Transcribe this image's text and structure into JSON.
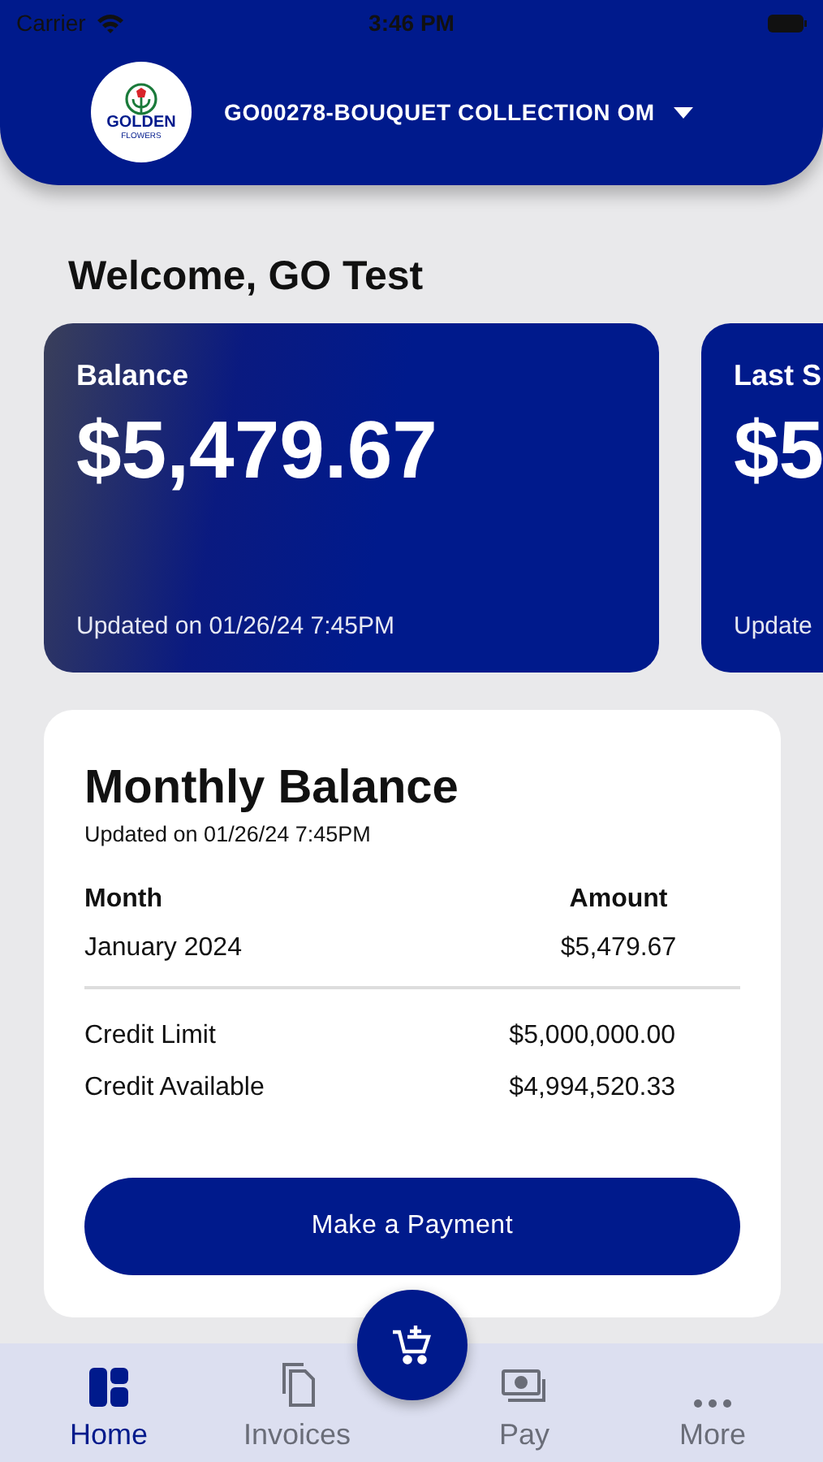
{
  "status_bar": {
    "carrier": "Carrier",
    "time": "3:46 PM"
  },
  "header": {
    "logo": {
      "name": "GOLDEN",
      "tagline": "FLOWERS"
    },
    "account": "GO00278-BOUQUET COLLECTION OM"
  },
  "welcome": "Welcome, GO Test",
  "summary_cards": [
    {
      "title": "Balance",
      "amount": "$5,479.67",
      "updated": "Updated on 01/26/24 7:45PM"
    },
    {
      "title": "Last S",
      "amount": "$5",
      "updated": "Update"
    }
  ],
  "monthly_balance": {
    "title": "Monthly Balance",
    "updated": "Updated on 01/26/24 7:45PM",
    "columns": [
      "Month",
      "Amount"
    ],
    "rows": [
      {
        "month": "January 2024",
        "amount": "$5,479.67"
      }
    ],
    "credit": [
      {
        "label": "Credit Limit",
        "value": "$5,000,000.00"
      },
      {
        "label": "Credit Available",
        "value": "$4,994,520.33"
      }
    ],
    "button": "Make a Payment"
  },
  "tabs": [
    {
      "kind": "home",
      "label": "Home",
      "selected": true
    },
    {
      "kind": "invoices",
      "label": "Invoices",
      "selected": false
    },
    {
      "kind": "pay",
      "label": "Pay",
      "selected": false
    },
    {
      "kind": "more",
      "label": "More",
      "selected": false
    }
  ]
}
